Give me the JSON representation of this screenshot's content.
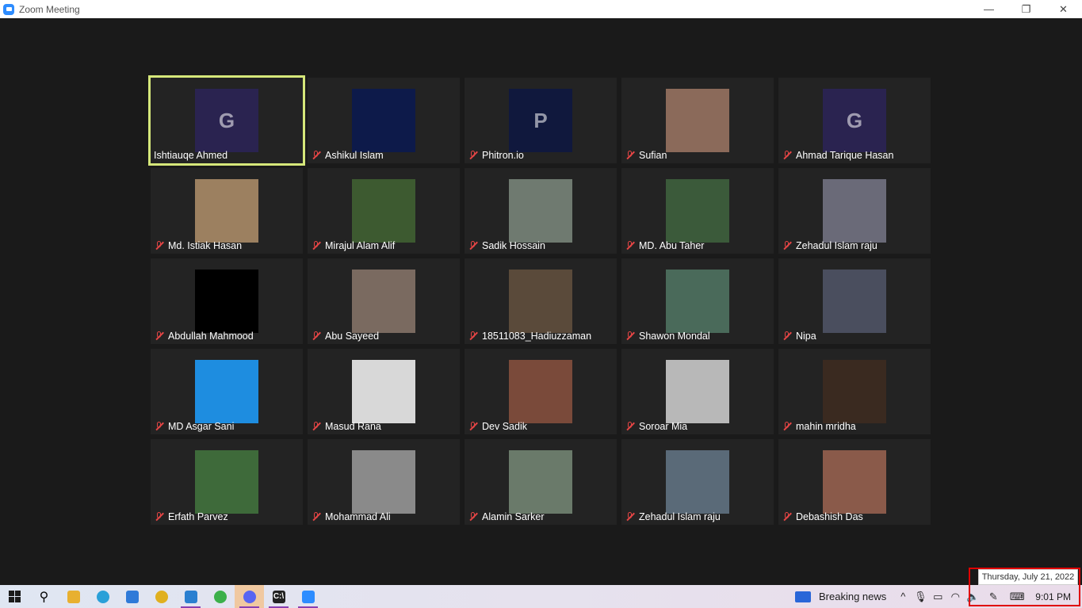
{
  "window": {
    "title": "Zoom Meeting",
    "minimize": "—",
    "restore": "❐",
    "close": "✕"
  },
  "participants": [
    {
      "name": "Ishtiauqe Ahmed",
      "muted": false,
      "active": true,
      "avatar_color": "#2a2350",
      "glyph": "G"
    },
    {
      "name": "Ashikul Islam",
      "muted": true,
      "avatar_color": "#0d1a4a",
      "glyph": ""
    },
    {
      "name": "Phitron.io",
      "muted": true,
      "avatar_color": "#10183d",
      "glyph": "P"
    },
    {
      "name": "Sufian",
      "muted": true,
      "avatar_color": "#8b6a5a",
      "glyph": ""
    },
    {
      "name": "Ahmad Tarique Hasan",
      "muted": true,
      "avatar_color": "#2a2350",
      "glyph": "G"
    },
    {
      "name": "Md. Istiak Hasan",
      "muted": true,
      "avatar_color": "#9c8060",
      "glyph": ""
    },
    {
      "name": "Mirajul Alam Alif",
      "muted": true,
      "avatar_color": "#3d5a30",
      "glyph": ""
    },
    {
      "name": "Sadik Hossain",
      "muted": true,
      "avatar_color": "#6f7a70",
      "glyph": ""
    },
    {
      "name": "MD. Abu Taher",
      "muted": true,
      "avatar_color": "#3b5a3a",
      "glyph": ""
    },
    {
      "name": "Zehadul Islam raju",
      "muted": true,
      "avatar_color": "#6a6a78",
      "glyph": ""
    },
    {
      "name": "Abdullah Mahmood",
      "muted": true,
      "avatar_color": "#000000",
      "glyph": ""
    },
    {
      "name": "Abu Sayeed",
      "muted": true,
      "avatar_color": "#7a6a60",
      "glyph": ""
    },
    {
      "name": "18511083_Hadiuzzaman",
      "muted": true,
      "avatar_color": "#5a4a3a",
      "glyph": ""
    },
    {
      "name": "Shawon Mondal",
      "muted": true,
      "avatar_color": "#4a6a5a",
      "glyph": ""
    },
    {
      "name": "Nipa",
      "muted": true,
      "avatar_color": "#4a4e5e",
      "glyph": ""
    },
    {
      "name": "MD Asgar Sani",
      "muted": true,
      "avatar_color": "#1e8de0",
      "glyph": ""
    },
    {
      "name": "Masud Rana",
      "muted": true,
      "avatar_color": "#d8d8d8",
      "glyph": ""
    },
    {
      "name": "Dev Sadik",
      "muted": true,
      "avatar_color": "#7a4a3a",
      "glyph": ""
    },
    {
      "name": "Soroar Mia",
      "muted": true,
      "avatar_color": "#b8b8b8",
      "glyph": ""
    },
    {
      "name": "mahin mridha",
      "muted": true,
      "avatar_color": "#3a2a20",
      "glyph": ""
    },
    {
      "name": "Erfath Parvez",
      "muted": true,
      "avatar_color": "#3e6a3a",
      "glyph": ""
    },
    {
      "name": "Mohammad Ali",
      "muted": true,
      "avatar_color": "#8a8a8a",
      "glyph": ""
    },
    {
      "name": "Alamin Sarker",
      "muted": true,
      "avatar_color": "#6a7a6a",
      "glyph": ""
    },
    {
      "name": "Zehadul Islam raju",
      "muted": true,
      "avatar_color": "#5a6a78",
      "glyph": ""
    },
    {
      "name": "Debashish Das",
      "muted": true,
      "avatar_color": "#8a5a4a",
      "glyph": ""
    }
  ],
  "taskbar": {
    "apps": [
      {
        "id": "start",
        "icon": "windows-icon"
      },
      {
        "id": "search",
        "icon": "search-icon",
        "glyph": "⚲"
      },
      {
        "id": "files",
        "icon": "file-explorer-icon",
        "color": "#e8b030"
      },
      {
        "id": "telegram",
        "icon": "telegram-icon",
        "color": "#2aa0d8"
      },
      {
        "id": "notepad",
        "icon": "text-editor-icon",
        "color": "#2f7ad8"
      },
      {
        "id": "chrome",
        "icon": "chrome-icon",
        "color": "#e0b020"
      },
      {
        "id": "vscode",
        "icon": "vscode-icon",
        "color": "#2a7fd0"
      },
      {
        "id": "sharefile",
        "icon": "share-icon",
        "color": "#3cb04a"
      },
      {
        "id": "discord",
        "icon": "discord-icon",
        "color": "#5865f2"
      },
      {
        "id": "terminal",
        "icon": "terminal-icon",
        "color": "#222222",
        "glyph": "C:\\"
      },
      {
        "id": "zoom",
        "icon": "zoom-icon",
        "color": "#2d8cff"
      }
    ],
    "news_label": "Breaking news",
    "time": "9:01 PM",
    "date_tooltip": "Thursday, July 21, 2022"
  }
}
